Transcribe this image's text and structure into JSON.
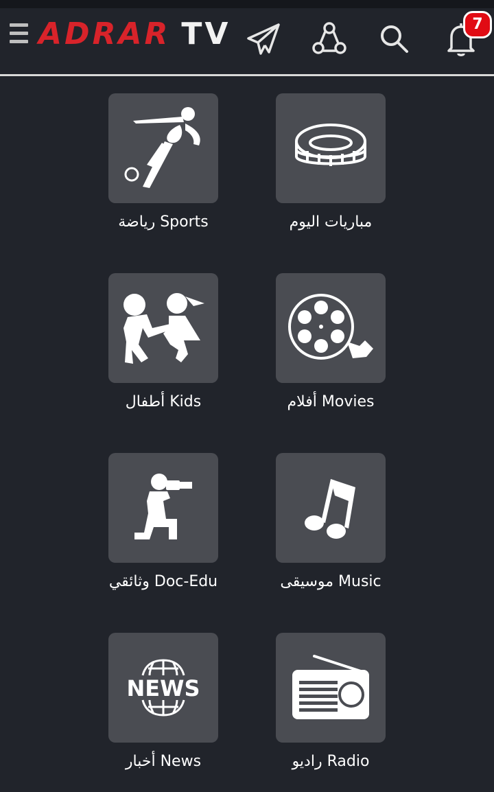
{
  "app": {
    "logo_part1": "ADRAR",
    "logo_part2": "TV",
    "notification_count": "7"
  },
  "header": {
    "icons": [
      "menu-icon",
      "telegram-icon",
      "share-icon",
      "search-icon",
      "bell-icon"
    ]
  },
  "categories": [
    {
      "label": "رياضة Sports",
      "icon": "sports-icon"
    },
    {
      "label": "مباريات اليوم",
      "icon": "stadium-icon"
    },
    {
      "label": "أطفال Kids",
      "icon": "kids-icon"
    },
    {
      "label": "أفلام Movies",
      "icon": "film-reel-icon"
    },
    {
      "label": "وثائقي Doc-Edu",
      "icon": "camera-man-icon"
    },
    {
      "label": "موسيقى Music",
      "icon": "music-note-icon"
    },
    {
      "label": "أخبار News",
      "icon": "news-globe-icon"
    },
    {
      "label": "راديو Radio",
      "icon": "radio-icon"
    }
  ],
  "colors": {
    "background": "#21242b",
    "tile": "#4a4c52",
    "brand_red": "#d8232a",
    "badge_red": "#e10b14"
  }
}
